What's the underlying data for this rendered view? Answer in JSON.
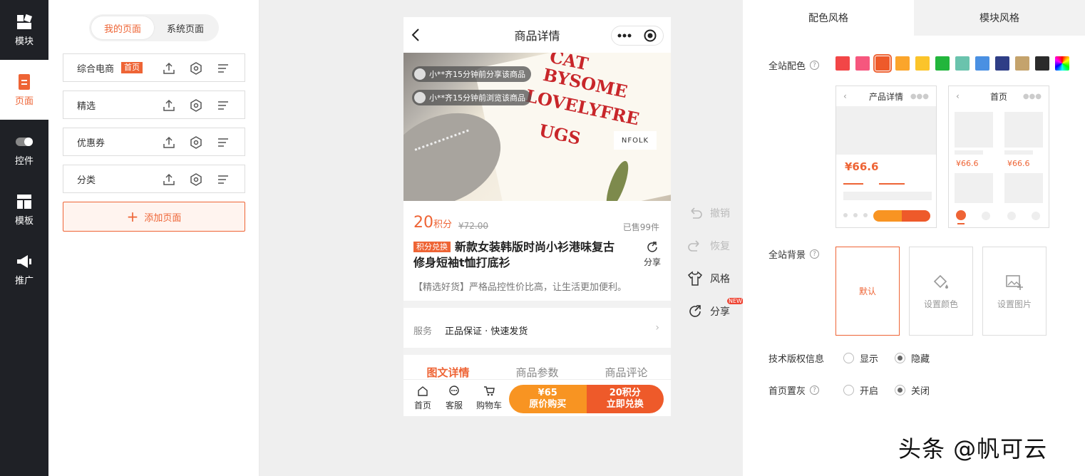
{
  "leftnav": {
    "items": [
      {
        "label": "模块",
        "icon": "module-icon"
      },
      {
        "label": "页面",
        "icon": "page-icon"
      },
      {
        "label": "控件",
        "icon": "toggle-icon"
      },
      {
        "label": "模板",
        "icon": "template-icon"
      },
      {
        "label": "推广",
        "icon": "megaphone-icon"
      }
    ],
    "active": "页面"
  },
  "pages": {
    "tabs": [
      "我的页面",
      "系统页面"
    ],
    "rows": [
      {
        "name": "综合电商",
        "badge": "首页"
      },
      {
        "name": "精选",
        "badge": ""
      },
      {
        "name": "优惠券",
        "badge": ""
      },
      {
        "name": "分类",
        "badge": ""
      }
    ],
    "add_label": "添加页面"
  },
  "phone": {
    "title": "商品详情",
    "banner_text": {
      "line1": "CAT",
      "line2": "BYSOME",
      "line3": "LOVELYFRE",
      "line4": "UGS",
      "tag": "NFOLK"
    },
    "share_tips": [
      "小**齐15分钟前分享该商品",
      "小**齐15分钟前浏览该商品"
    ],
    "price": "20",
    "price_unit": "积分",
    "orig_price": "¥72.00",
    "sold": "已售99件",
    "product_tag": "积分兑换",
    "product_title": "新款女装韩版时尚小衫港味复古修身短袖t恤打底衫",
    "share_label": "分享",
    "desc": "【精选好货】严格品控性价比高，让生活更加便利。",
    "service_label": "服务",
    "service_value": "正品保证 · 快速发货",
    "tabs": [
      "图文详情",
      "商品参数",
      "商品评论"
    ],
    "bottom": {
      "home": "首页",
      "service": "客服",
      "cart": "购物车",
      "buy_price": "¥65",
      "buy_label": "原价购买",
      "redeem_price": "20积分",
      "redeem_label": "立即兑换"
    }
  },
  "tools": {
    "undo": "撤销",
    "redo": "恢复",
    "style": "风格",
    "share": "分享",
    "new_badge": "NEW"
  },
  "right": {
    "tabs": [
      "配色风格",
      "模块风格"
    ],
    "color_label": "全站配色",
    "colors": [
      "#f24647",
      "#f6577e",
      "#ee5a2a",
      "#fba52b",
      "#fbc42a",
      "#22b63c",
      "#6ac3ad",
      "#4a90e2",
      "#2f3e86",
      "#c4a36c",
      "#2b2b2b",
      "rainbow"
    ],
    "preview1": {
      "title": "产品详情",
      "price": "¥66.6"
    },
    "preview2": {
      "title": "首页",
      "price1": "¥66.6",
      "price2": "¥66.6"
    },
    "bg_label": "全站背景",
    "bg_options": [
      "默认",
      "设置颜色",
      "设置图片"
    ],
    "copyright_label": "技术版权信息",
    "copyright_options": [
      "显示",
      "隐藏"
    ],
    "copyright_selected": "隐藏",
    "gray_label": "首页置灰",
    "gray_options": [
      "开启",
      "关闭"
    ],
    "gray_selected": "关闭"
  },
  "watermark": "头条 @帆可云"
}
